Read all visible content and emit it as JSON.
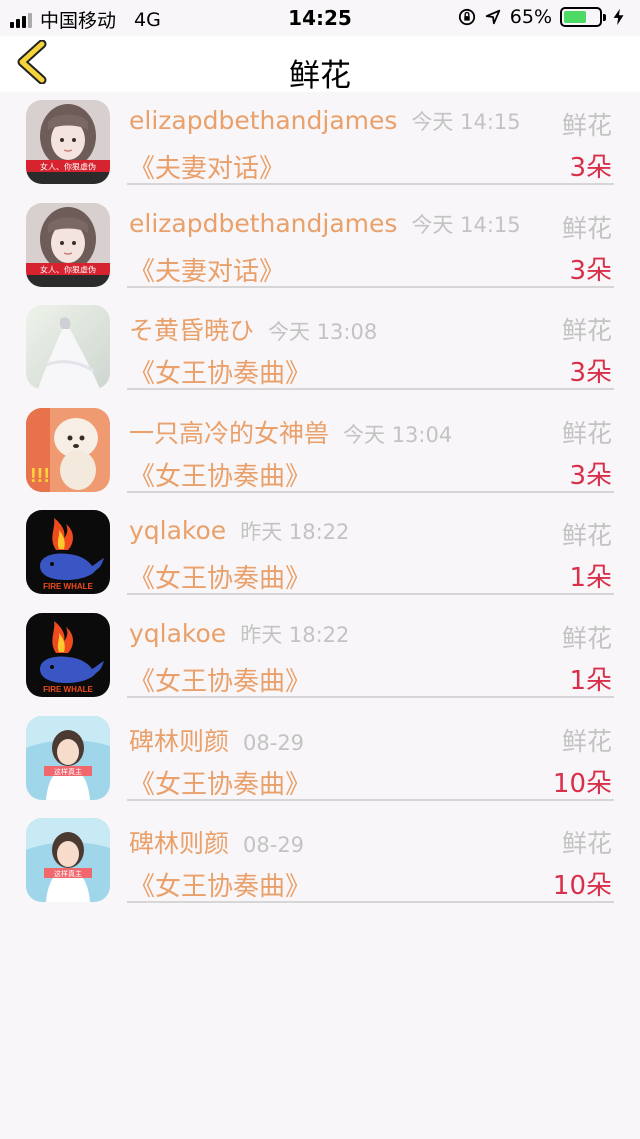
{
  "status_bar": {
    "carrier": "中国移动",
    "network": "4G",
    "time": "14:25",
    "battery_percent_label": "65%",
    "battery_level": 0.65,
    "battery_color": "#4cd964"
  },
  "nav": {
    "back_icon": "chevron-left-icon",
    "title": "鲜花"
  },
  "colors": {
    "accent": "#e9a06a",
    "count": "#d8304a",
    "muted": "#c3c3c3"
  },
  "rows": [
    {
      "name": "elizapdbethandjames",
      "time": "今天 14:15",
      "gift": "鲜花",
      "work": "《夫妻对话》",
      "count": "3朵",
      "avatar": "girl-photo-1"
    },
    {
      "name": "elizapdbethandjames",
      "time": "今天 14:15",
      "gift": "鲜花",
      "work": "《夫妻对话》",
      "count": "3朵",
      "avatar": "girl-photo-1"
    },
    {
      "name": "そ黄昏暁ひ",
      "time": "今天 13:08",
      "gift": "鲜花",
      "work": "《女王协奏曲》",
      "count": "3朵",
      "avatar": "bride-photo"
    },
    {
      "name": "一只高冷的女神兽",
      "time": "今天 13:04",
      "gift": "鲜花",
      "work": "《女王协奏曲》",
      "count": "3朵",
      "avatar": "poodle-photo"
    },
    {
      "name": "yqlakoe",
      "time": "昨天 18:22",
      "gift": "鲜花",
      "work": "《女王协奏曲》",
      "count": "1朵",
      "avatar": "fire-whale-logo"
    },
    {
      "name": "yqlakoe",
      "time": "昨天 18:22",
      "gift": "鲜花",
      "work": "《女王协奏曲》",
      "count": "1朵",
      "avatar": "fire-whale-logo"
    },
    {
      "name": "碑林则颜",
      "time": "08-29",
      "gift": "鲜花",
      "work": "《女王协奏曲》",
      "count": "10朵",
      "avatar": "girl-photo-2"
    },
    {
      "name": "碑林则颜",
      "time": "08-29",
      "gift": "鲜花",
      "work": "《女王协奏曲》",
      "count": "10朵",
      "avatar": "girl-photo-2"
    }
  ],
  "avatar_texts": {
    "girl-photo-1": "女人、你狠虚伪",
    "fire-whale-logo": "FIRE WHALE",
    "poodle-photo": "!!!",
    "girl-photo-2": "这样真主"
  }
}
